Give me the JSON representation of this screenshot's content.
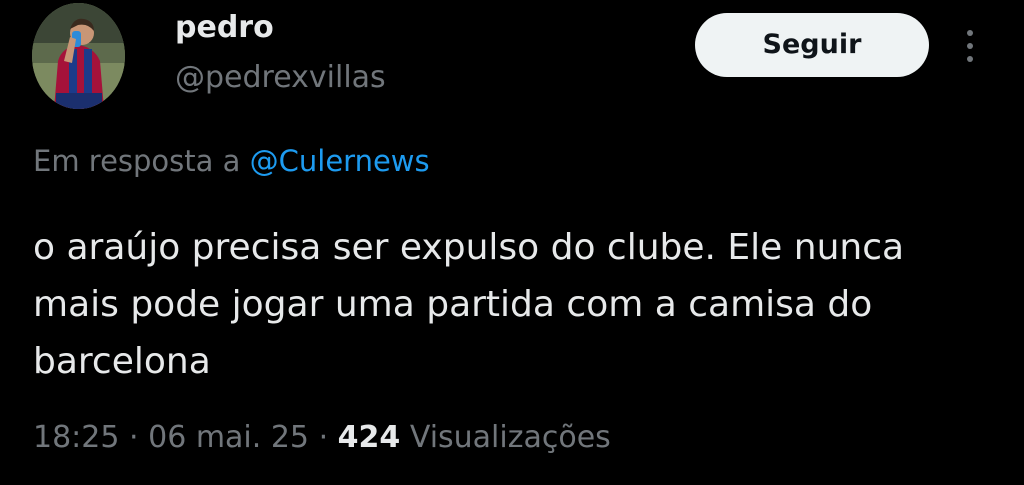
{
  "author": {
    "name": "pedro",
    "handle": "@pedrexvillas",
    "avatar_icon": "user-avatar-photo"
  },
  "actions": {
    "follow_label": "Seguir",
    "more_icon": "more-vertical-icon"
  },
  "reply": {
    "prefix": "Em resposta a",
    "mention": "@Culernews"
  },
  "tweet": {
    "text": "o araújo precisa ser expulso do clube. Ele nunca mais pode jogar uma partida com a camisa do barcelona"
  },
  "meta": {
    "time": "18:25",
    "date": "06 mai. 25",
    "separator": "·",
    "views_count": "424",
    "views_label": "Visualizações"
  },
  "colors": {
    "background": "#000000",
    "primary_text": "#e7e9ea",
    "secondary_text": "#71767b",
    "link": "#1d9bf0",
    "button_bg": "#eff3f4",
    "button_text": "#0f1419"
  }
}
